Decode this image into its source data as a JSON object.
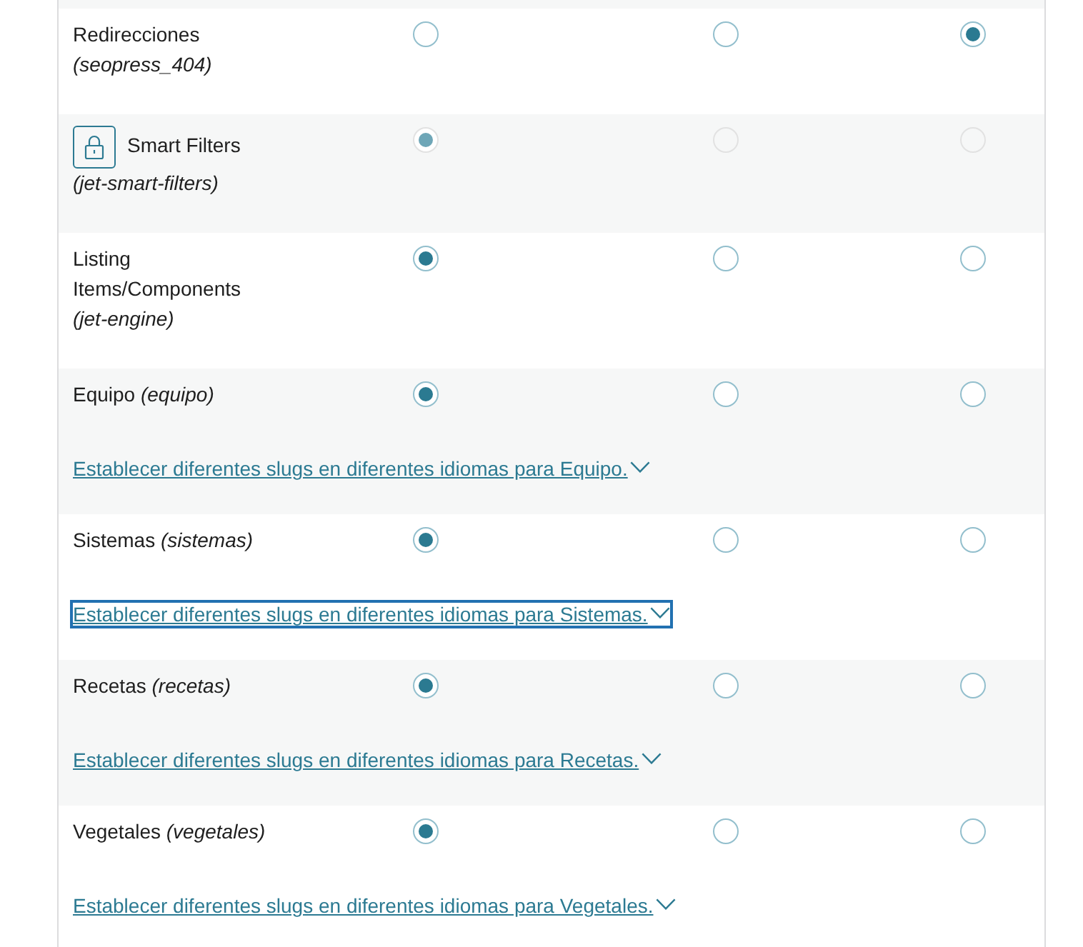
{
  "rows": [
    {
      "name": "Redirecciones",
      "slug": "(seopress_404)",
      "locked": false,
      "options": [
        {
          "selected": false
        },
        {
          "selected": false
        },
        {
          "selected": true
        }
      ]
    },
    {
      "name": "Smart Filters",
      "slug": "(jet-smart-filters)",
      "locked": true,
      "options": [
        {
          "selected": true
        },
        {
          "selected": false
        },
        {
          "selected": false
        }
      ]
    },
    {
      "name": "Listing Items/Components",
      "slug": "(jet-engine)",
      "locked": false,
      "options": [
        {
          "selected": true
        },
        {
          "selected": false
        },
        {
          "selected": false
        }
      ]
    },
    {
      "name": "Equipo",
      "slug": "(equipo)",
      "locked": false,
      "options": [
        {
          "selected": true
        },
        {
          "selected": false
        },
        {
          "selected": false
        }
      ],
      "slug_link": {
        "label": "Establecer diferentes slugs en diferentes idiomas para Equipo.",
        "focused": false
      }
    },
    {
      "name": "Sistemas",
      "slug": "(sistemas)",
      "locked": false,
      "options": [
        {
          "selected": true
        },
        {
          "selected": false
        },
        {
          "selected": false
        }
      ],
      "slug_link": {
        "label": "Establecer diferentes slugs en diferentes idiomas para Sistemas.",
        "focused": true
      }
    },
    {
      "name": "Recetas",
      "slug": "(recetas)",
      "locked": false,
      "options": [
        {
          "selected": true
        },
        {
          "selected": false
        },
        {
          "selected": false
        }
      ],
      "slug_link": {
        "label": "Establecer diferentes slugs en diferentes idiomas para Recetas.",
        "focused": false
      }
    },
    {
      "name": "Vegetales",
      "slug": "(vegetales)",
      "locked": false,
      "options": [
        {
          "selected": true
        },
        {
          "selected": false
        },
        {
          "selected": false
        }
      ],
      "slug_link": {
        "label": "Establecer diferentes slugs en diferentes idiomas para Vegetales.",
        "focused": false
      }
    }
  ]
}
